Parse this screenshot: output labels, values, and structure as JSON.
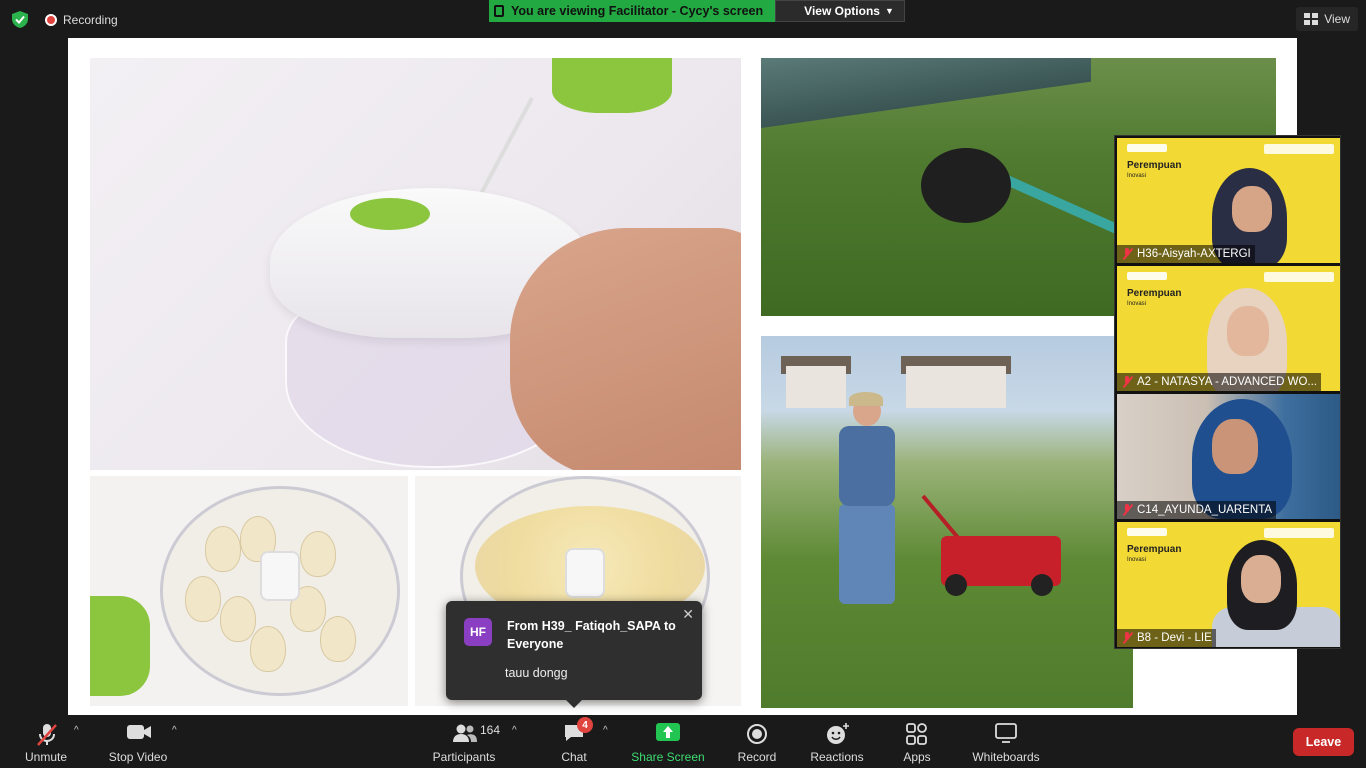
{
  "topbar": {
    "recording_label": "Recording",
    "banner_text": "You are viewing Facilitator - Cycy's screen",
    "view_options_label": "View Options",
    "view_label": "View"
  },
  "chat_toast": {
    "avatar_initials": "HF",
    "from": "From H39_ Fatiqoh_SAPA to Everyone",
    "message": "tauu dongg"
  },
  "participants_tiles": [
    {
      "name": "H36-Aisyah-AXTERGI",
      "muted": true,
      "banner_title": "Perempuan",
      "banner_sub": "Inovasi"
    },
    {
      "name": "A2 - NATASYA - ADVANCED WO...",
      "muted": true,
      "banner_title": "Perempuan",
      "banner_sub": "Inovasi"
    },
    {
      "name": "C14_AYUNDA_UARENTA",
      "muted": true
    },
    {
      "name": "B8 - Devi - LIE",
      "muted": true,
      "banner_title": "Perempuan",
      "banner_sub": "Inovasi"
    }
  ],
  "toolbar": {
    "unmute": "Unmute",
    "stop_video": "Stop Video",
    "participants": "Participants",
    "participants_count": "164",
    "chat": "Chat",
    "chat_badge": "4",
    "share_screen": "Share Screen",
    "record": "Record",
    "reactions": "Reactions",
    "apps": "Apps",
    "whiteboards": "Whiteboards",
    "leave": "Leave"
  },
  "colors": {
    "banner_green": "#23a942",
    "leave_red": "#c82828",
    "share_green": "#23c552",
    "tile_yellow": "#f2d934",
    "avatar_purple": "#8a3fc2"
  }
}
